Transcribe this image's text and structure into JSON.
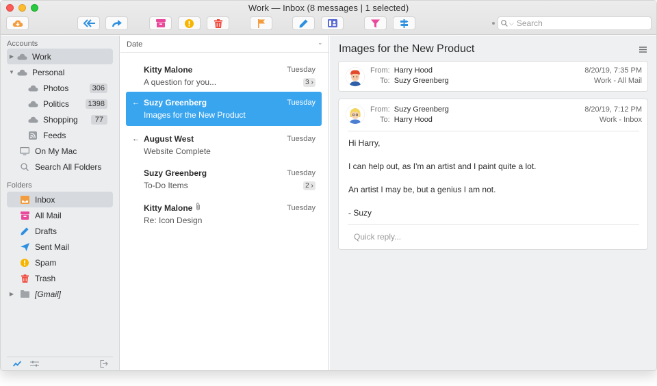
{
  "window": {
    "title": "Work — Inbox (8 messages | 1 selected)"
  },
  "toolbar": {
    "search_placeholder": "Search",
    "search_menu": "⌵"
  },
  "sidebar": {
    "accounts_label": "Accounts",
    "accounts": [
      {
        "label": "Work",
        "disclosure": "▶",
        "selected": true
      },
      {
        "label": "Personal",
        "disclosure": "▼",
        "selected": false
      }
    ],
    "personal_children": [
      {
        "label": "Photos",
        "count": "306"
      },
      {
        "label": "Politics",
        "count": "1398"
      },
      {
        "label": "Shopping",
        "count": "77"
      },
      {
        "label": "Feeds",
        "count": ""
      }
    ],
    "other_items": [
      {
        "label": "On My Mac"
      },
      {
        "label": "Search All Folders"
      }
    ],
    "folders_label": "Folders",
    "folders": [
      {
        "label": "Inbox",
        "icon": "inbox-icon",
        "color": "#f39c3d",
        "selected": true
      },
      {
        "label": "All Mail",
        "icon": "all-mail-icon",
        "color": "#e9489b",
        "selected": false
      },
      {
        "label": "Drafts",
        "icon": "pencil-icon",
        "color": "#2d8fe0",
        "selected": false
      },
      {
        "label": "Sent Mail",
        "icon": "paper-plane-icon",
        "color": "#2d8fe0",
        "selected": false
      },
      {
        "label": "Spam",
        "icon": "spam-icon",
        "color": "#f7b500",
        "selected": false
      },
      {
        "label": "Trash",
        "icon": "trash-icon",
        "color": "#ef4b3f",
        "selected": false
      },
      {
        "label": "[Gmail]",
        "icon": "folder-icon",
        "color": "#a0a4a8",
        "selected": false
      }
    ]
  },
  "message_list": {
    "sort_label": "Date",
    "sort_caret": "⌄",
    "messages": [
      {
        "sender": "Kitty Malone",
        "subject": "A question for you...",
        "date": "Tuesday",
        "count": "3 ›",
        "replied": false,
        "selected": false,
        "attachment": false
      },
      {
        "sender": "Suzy Greenberg",
        "subject": "Images for the New Product",
        "date": "Tuesday",
        "count": "",
        "replied": true,
        "selected": true,
        "attachment": false
      },
      {
        "sender": "August West",
        "subject": "Website Complete",
        "date": "Tuesday",
        "count": "",
        "replied": true,
        "selected": false,
        "attachment": false
      },
      {
        "sender": "Suzy Greenberg",
        "subject": "To-Do Items",
        "date": "Tuesday",
        "count": "2 ›",
        "replied": false,
        "selected": false,
        "attachment": false
      },
      {
        "sender": "Kitty Malone",
        "subject": "Re: Icon Design",
        "date": "Tuesday",
        "count": "",
        "replied": false,
        "selected": false,
        "attachment": true
      }
    ],
    "reply_glyph": "←"
  },
  "reader": {
    "title": "Images for the New Product",
    "from_label": "From:",
    "to_label": "To:",
    "message1": {
      "from": "Harry Hood",
      "to": "Suzy Greenberg",
      "date": "8/20/19, 7:35 PM",
      "folder": "Work - All Mail"
    },
    "message2": {
      "from": "Suzy Greenberg",
      "to": "Harry Hood",
      "date": "8/20/19, 7:12 PM",
      "folder": "Work - Inbox",
      "body": [
        "Hi Harry,",
        "I can help out, as I'm an artist and I paint quite a lot.",
        "An artist I may be, but a genius I am not.",
        "- Suzy"
      ]
    },
    "quick_reply_placeholder": "Quick reply..."
  },
  "colors": {
    "accent": "#3aa5ef",
    "orange": "#f39c3d",
    "pink": "#e9489b",
    "blue": "#2d8fe0",
    "yellow": "#f7b500",
    "red": "#ef4b3f"
  }
}
